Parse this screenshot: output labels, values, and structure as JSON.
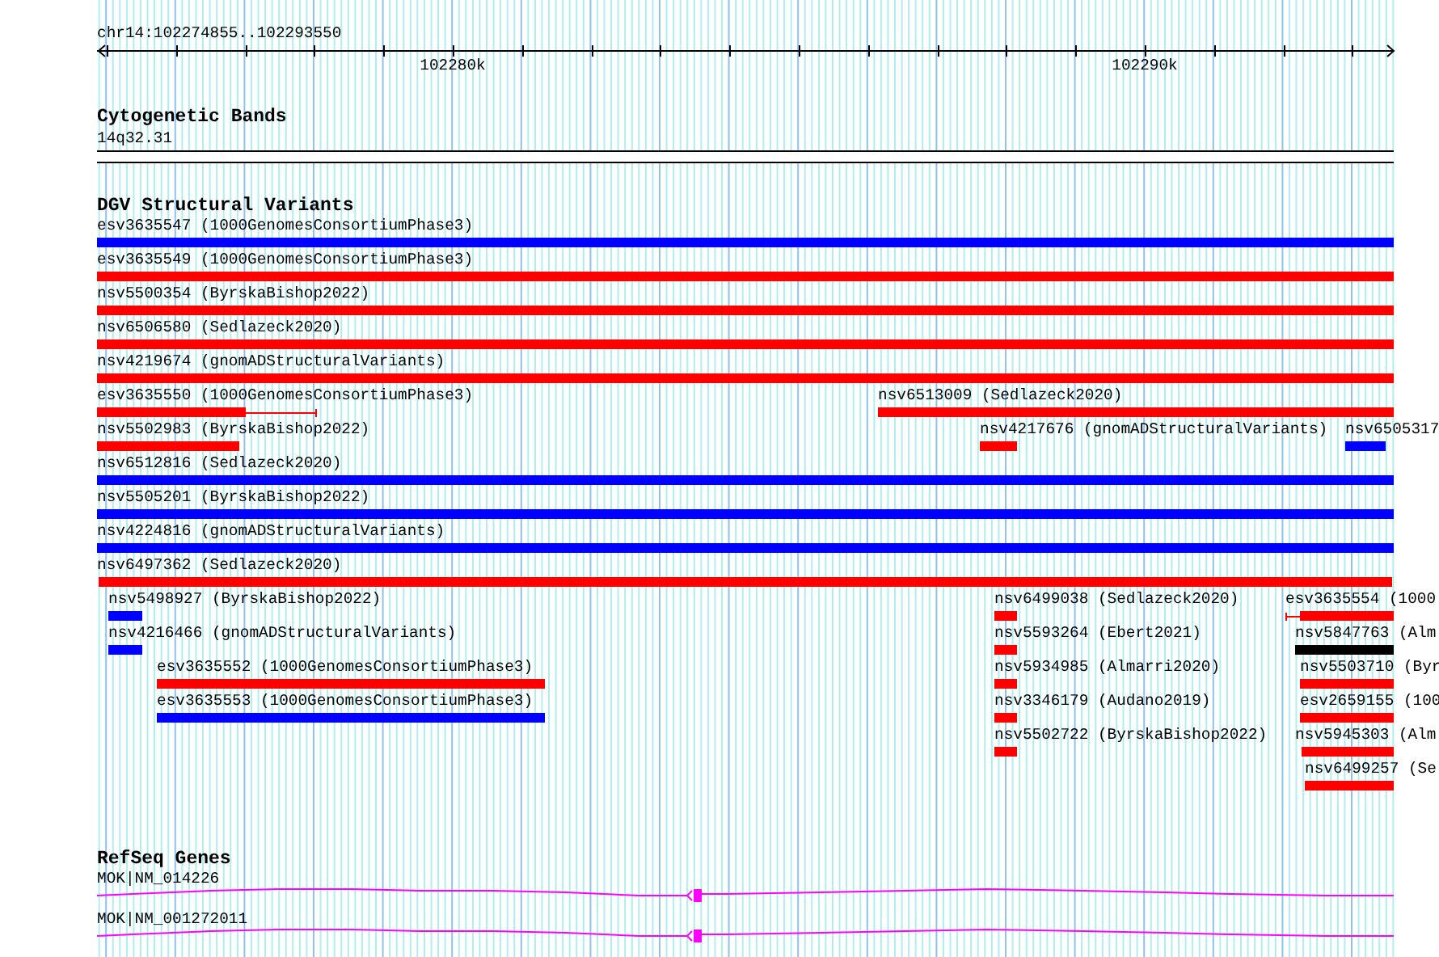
{
  "ruler": {
    "location": "chr14:102274855..102293550",
    "tick_labels": [
      "102280k",
      "102290k"
    ]
  },
  "cytogenetic_bands": {
    "title": "Cytogenetic Bands",
    "band": "14q32.31"
  },
  "dgv_structural_variants": {
    "title": "DGV Structural Variants",
    "features": [
      {
        "label": "esv3635547 (1000GenomesConsortiumPhase3)",
        "color": "#0000ff",
        "kind": "bar"
      },
      {
        "label": "esv3635549 (1000GenomesConsortiumPhase3)",
        "color": "#ff0000",
        "kind": "bar"
      },
      {
        "label": "nsv5500354 (ByrskaBishop2022)",
        "color": "#ff0000",
        "kind": "bar"
      },
      {
        "label": "nsv6506580 (Sedlazeck2020)",
        "color": "#ff0000",
        "kind": "bar"
      },
      {
        "label": "nsv4219674 (gnomADStructuralVariants)",
        "color": "#ff0000",
        "kind": "bar"
      },
      {
        "label": "esv3635550 (1000GenomesConsortiumPhase3)",
        "color": "#ff0000",
        "kind": "split"
      },
      {
        "label": "nsv6513009 (Sedlazeck2020)",
        "color": "#ff0000",
        "kind": "bar"
      },
      {
        "label": "nsv5502983 (ByrskaBishop2022)",
        "color": "#ff0000",
        "kind": "bar"
      },
      {
        "label": "nsv4217676 (gnomADStructuralVariants)",
        "color": "#ff0000",
        "kind": "bar"
      },
      {
        "label": "nsv6505317",
        "color": "#0000ff",
        "kind": "bar"
      },
      {
        "label": "nsv6512816 (Sedlazeck2020)",
        "color": "#0000ff",
        "kind": "bar"
      },
      {
        "label": "nsv5505201 (ByrskaBishop2022)",
        "color": "#0000ff",
        "kind": "bar"
      },
      {
        "label": "nsv4224816 (gnomADStructuralVariants)",
        "color": "#0000ff",
        "kind": "bar"
      },
      {
        "label": "nsv6497362 (Sedlazeck2020)",
        "color": "#ff0000",
        "kind": "bar"
      },
      {
        "label": "nsv5498927 (ByrskaBishop2022)",
        "color": "#0000ff",
        "kind": "bar"
      },
      {
        "label": "nsv6499038 (Sedlazeck2020)",
        "color": "#ff0000",
        "kind": "bar"
      },
      {
        "label": "esv3635554 (1000",
        "color": "#ff0000",
        "kind": "split"
      },
      {
        "label": "nsv4216466 (gnomADStructuralVariants)",
        "color": "#0000ff",
        "kind": "bar"
      },
      {
        "label": "nsv5593264 (Ebert2021)",
        "color": "#ff0000",
        "kind": "bar"
      },
      {
        "label": "nsv5847763 (Alm",
        "color": "#000000",
        "kind": "bar"
      },
      {
        "label": "esv3635552 (1000GenomesConsortiumPhase3)",
        "color": "#ff0000",
        "kind": "bar"
      },
      {
        "label": "nsv5934985 (Almarri2020)",
        "color": "#ff0000",
        "kind": "bar"
      },
      {
        "label": "nsv5503710 (Byr",
        "color": "#ff0000",
        "kind": "bar"
      },
      {
        "label": "esv3635553 (1000GenomesConsortiumPhase3)",
        "color": "#0000ff",
        "kind": "bar"
      },
      {
        "label": "nsv3346179 (Audano2019)",
        "color": "#ff0000",
        "kind": "bar"
      },
      {
        "label": "esv2659155 (100",
        "color": "#ff0000",
        "kind": "bar"
      },
      {
        "label": "nsv5502722 (ByrskaBishop2022)",
        "color": "#ff0000",
        "kind": "bar"
      },
      {
        "label": "nsv5945303 (Alm",
        "color": "#ff0000",
        "kind": "bar"
      },
      {
        "label": "nsv6499257 (Se",
        "color": "#ff0000",
        "kind": "bar"
      }
    ]
  },
  "refseq_genes": {
    "title": "RefSeq Genes",
    "genes": [
      {
        "label": "MOK|NM_014226"
      },
      {
        "label": "MOK|NM_001272011"
      }
    ]
  }
}
